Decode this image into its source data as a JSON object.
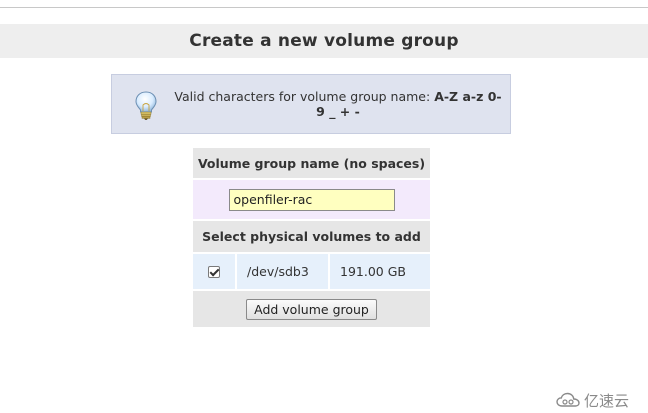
{
  "page": {
    "title": "Create a new volume group"
  },
  "info": {
    "text": "Valid characters for volume group name: ",
    "chars_line1": "A-Z a-z 0-",
    "chars_line2": "9 _ + -"
  },
  "form": {
    "name_header": "Volume group name (no spaces)",
    "name_value": "openfiler-rac",
    "pv_header": "Select physical volumes to add",
    "volumes": [
      {
        "checked": true,
        "device": "/dev/sdb3",
        "size": "191.00 GB"
      }
    ],
    "submit_label": "Add volume group"
  },
  "watermark": {
    "text": "亿速云"
  },
  "colors": {
    "title_bg": "#eeeeee",
    "info_bg": "#dfe3ef",
    "header_bg": "#e6e6e6",
    "name_row_bg": "#f3eafc",
    "input_bg": "#ffffc0",
    "volume_row_bg": "#e6f0fb"
  },
  "icons": {
    "info": "lightbulb-icon",
    "watermark_logo": "cloud-logo-icon"
  }
}
